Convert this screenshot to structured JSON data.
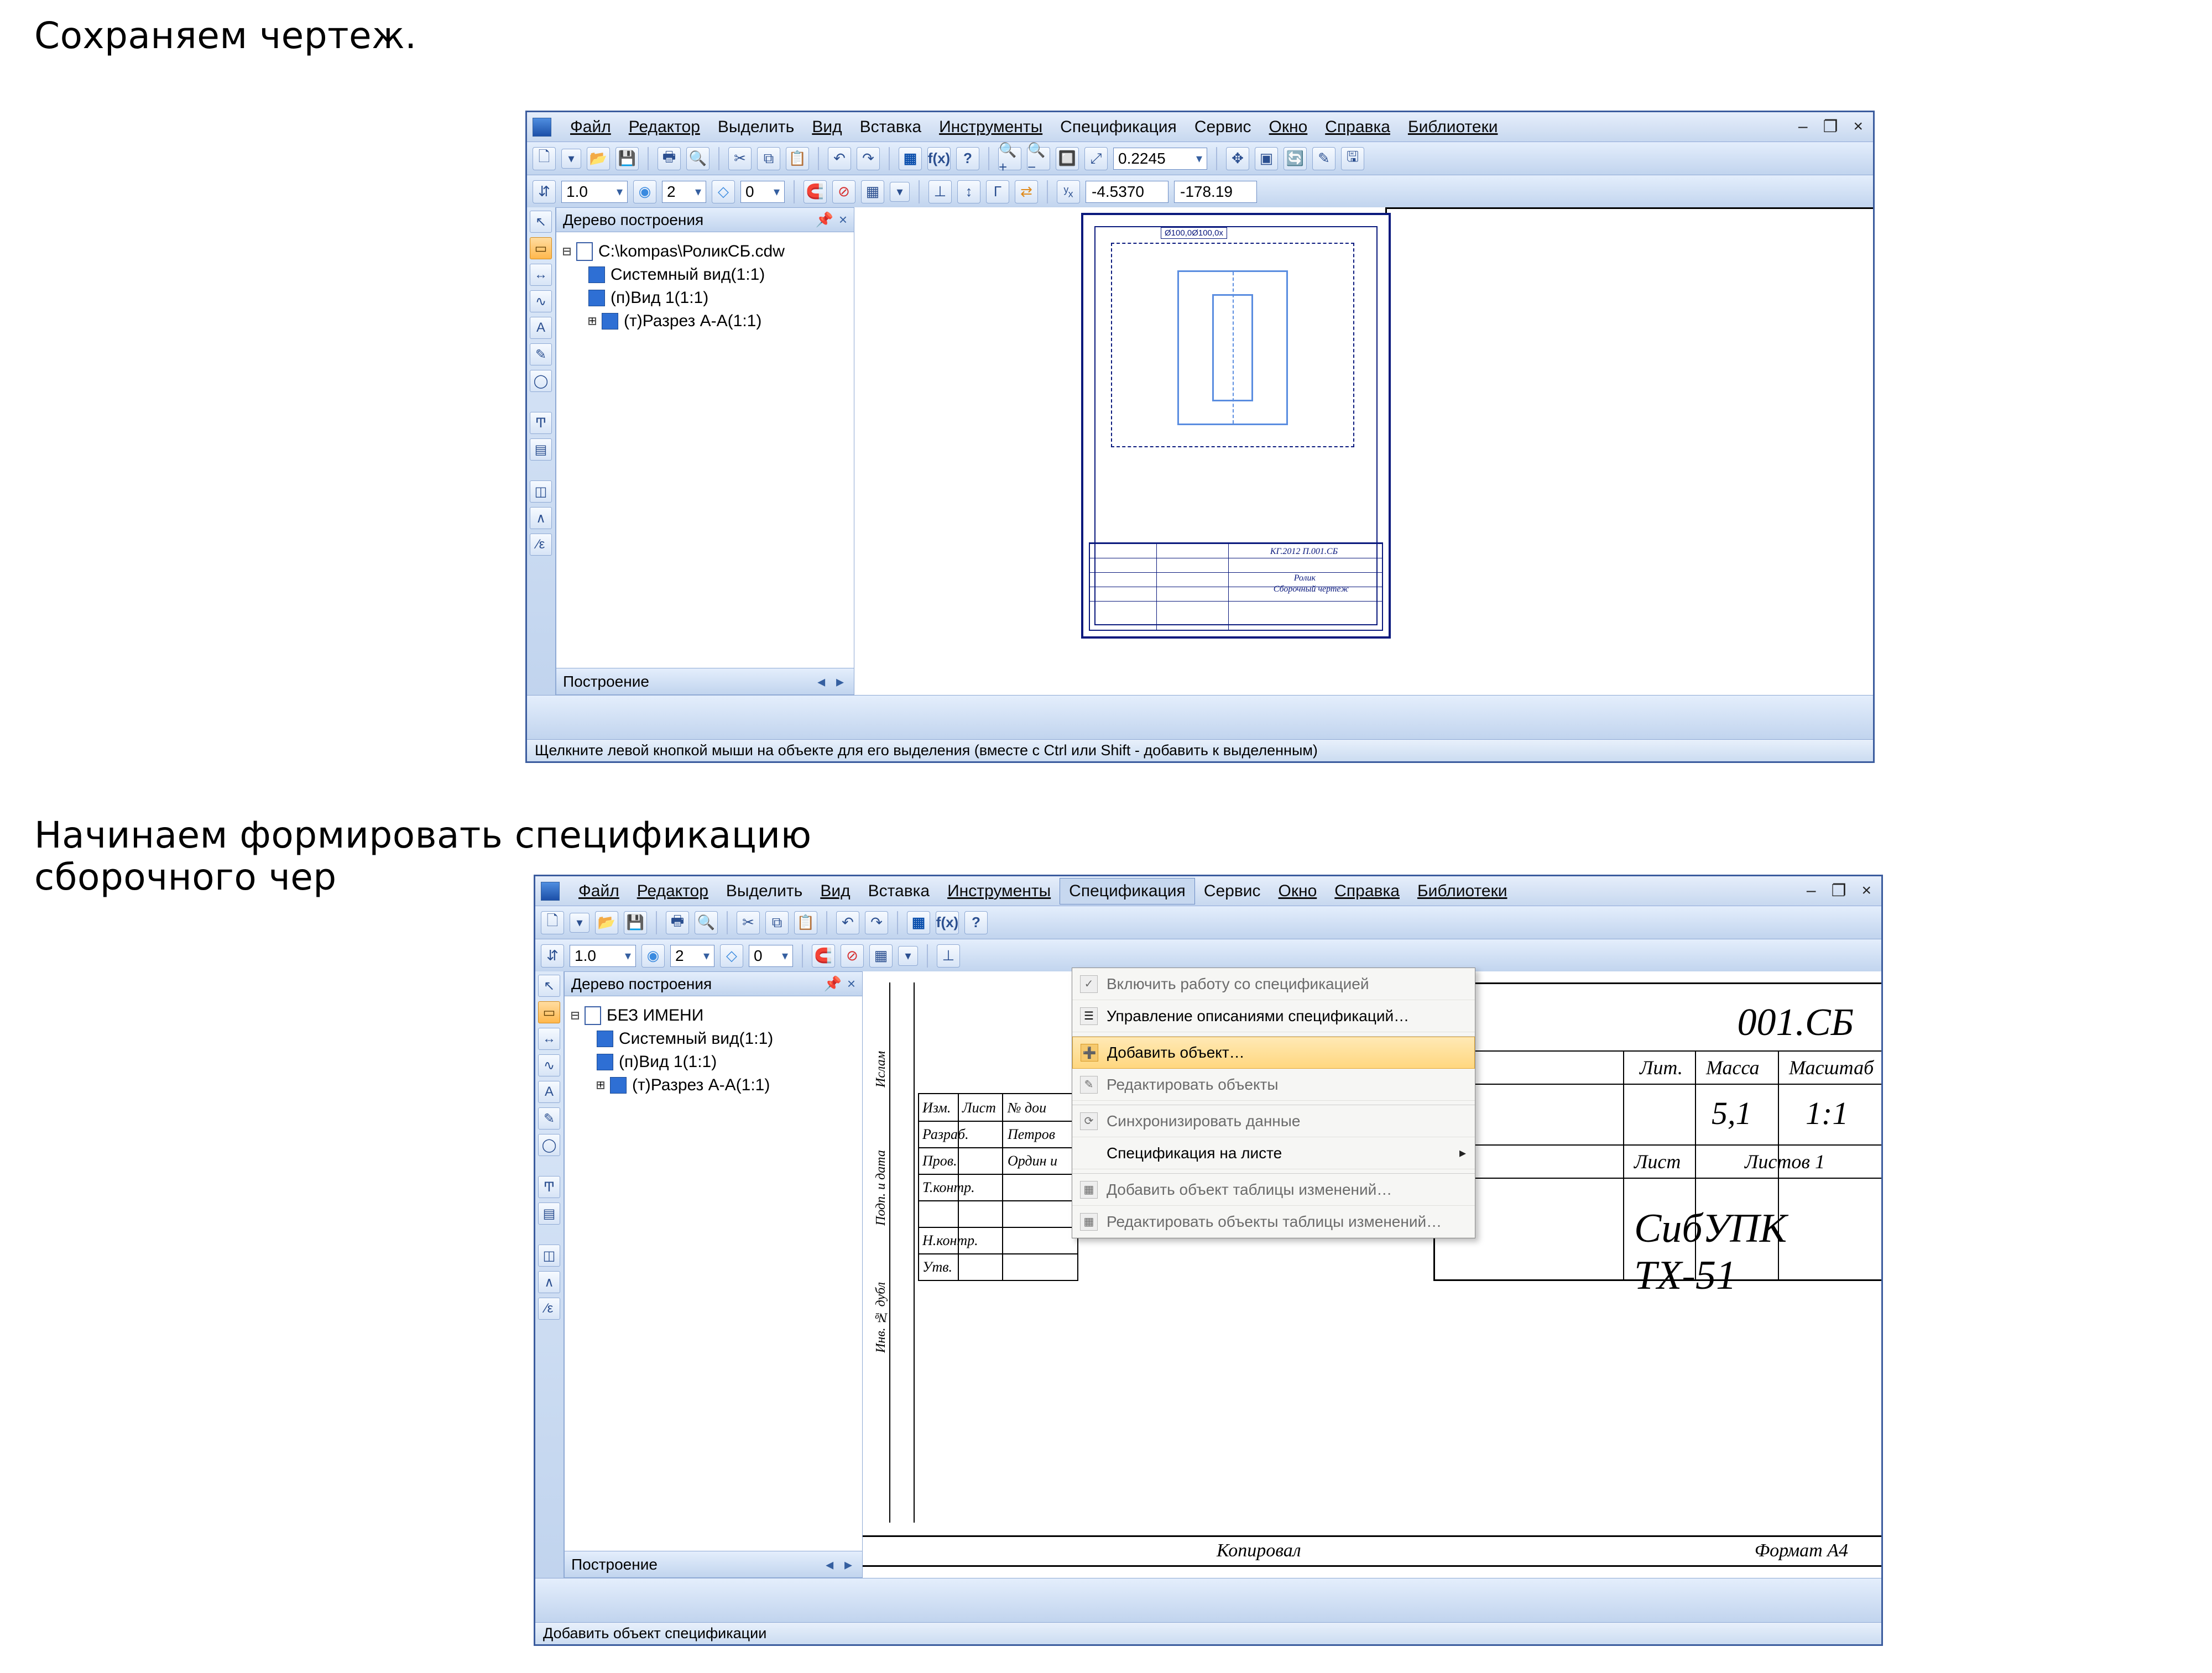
{
  "doc": {
    "line1": "Сохраняем чертеж.",
    "line2a": "Начинаем формировать спецификацию",
    "line2b": "сборочного чер"
  },
  "menus": [
    "Файл",
    "Редактор",
    "Выделить",
    "Вид",
    "Вставка",
    "Инструменты",
    "Спецификация",
    "Сервис",
    "Окно",
    "Справка",
    "Библиотеки"
  ],
  "menu_underline_idx": [
    0,
    0,
    -1,
    0,
    -1,
    0,
    -1,
    -1,
    0,
    0,
    0
  ],
  "winctrl": {
    "min": "–",
    "restore": "❐",
    "close": "×"
  },
  "toolbar1": {
    "zoom": "0.2245",
    "coords_x": "-4.5370",
    "coords_y": "-178.19",
    "step1": "1.0",
    "step2": "2",
    "step3": "0",
    "fx": "f(x)",
    "help": "?"
  },
  "tree": {
    "title": "Дерево построения",
    "pin": "📌",
    "close": "×",
    "doc1": "C:\\kompas\\РоликСБ.cdw",
    "doc2": "БЕЗ ИМЕНИ",
    "items": [
      "Системный вид(1:1)",
      "(п)Вид 1(1:1)",
      "(т)Разрез А-А(1:1)"
    ],
    "bottom_tab": "Построение",
    "arrows": "◂ ▸"
  },
  "status1": "Щелкните левой кнопкой мыши на объекте для его выделения (вместе с Ctrl или Shift - добавить к выделенным)",
  "status2": "Добавить объект спецификации",
  "sheet1": {
    "dim_top": "Ø100,0Ø100,0x",
    "code": "КГ.2012 П.001.СБ",
    "name1": "Ролик",
    "name2": "Сборочный чертеж"
  },
  "dropdown": {
    "items": [
      {
        "label": "Включить работу со спецификацией",
        "enabled": false,
        "check": true
      },
      {
        "label": "Управление описаниями спецификаций…",
        "enabled": true
      },
      {
        "sep": true
      },
      {
        "label": "Добавить объект…",
        "enabled": true,
        "hl": true
      },
      {
        "label": "Редактировать объекты",
        "enabled": false
      },
      {
        "sep": true
      },
      {
        "label": "Синхронизировать данные",
        "enabled": false
      },
      {
        "label": "Спецификация на листе",
        "enabled": true,
        "submenu": true
      },
      {
        "sep": true
      },
      {
        "label": "Добавить объект таблицы изменений…",
        "enabled": false
      },
      {
        "label": "Редактировать объекты таблицы изменений…",
        "enabled": false
      }
    ]
  },
  "tblock2": {
    "code": "001.СБ",
    "lit": "Лит.",
    "massa": "Масса",
    "mashtab": "Масштаб",
    "m_val": "5,1",
    "s_val": "1:1",
    "list": "Лист",
    "listov": "Листов   1",
    "org": "СибУПК ТХ-51",
    "izm": "Изм.",
    "listc": "Лист",
    "ndoc": "№ дои",
    "razrab": "Разраб.",
    "razrab_v": "Петров",
    "prov": "Пров.",
    "prov_v": "Ордин и",
    "tkontr": "Т.контр.",
    "nkontr": "Н.контр.",
    "utv": "Утв.",
    "kopiroval": "Копировал",
    "format": "Формат   А4",
    "vlabel1": "Ислам",
    "vlabel2": "Подп. и дата",
    "vlabel3": "Инв. № дубл"
  }
}
